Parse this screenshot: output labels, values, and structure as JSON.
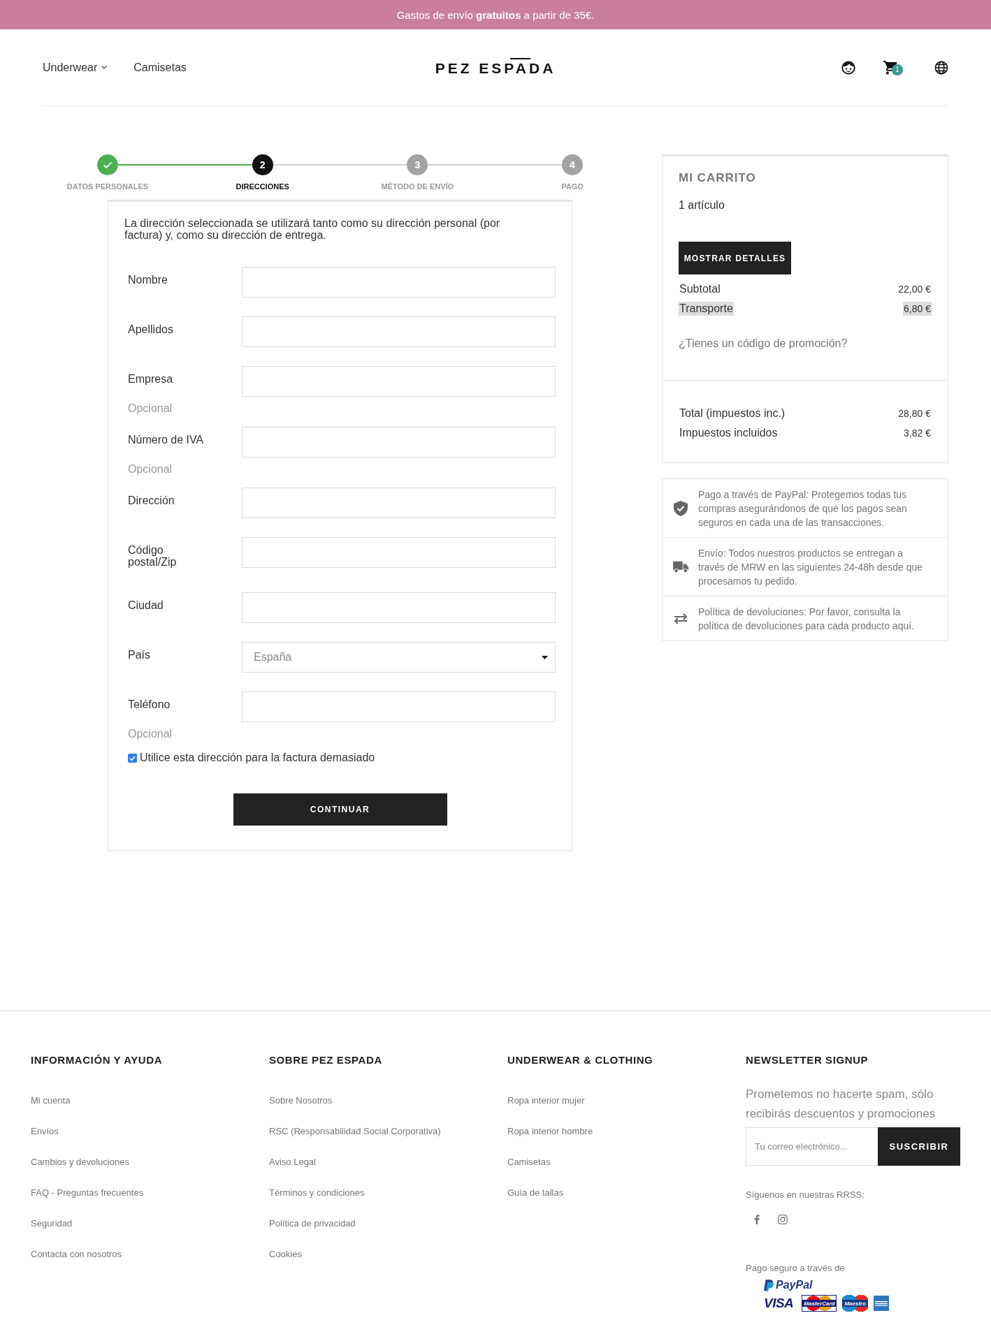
{
  "announcement": {
    "text": "Gastos de envío **gratuitos** a partir de 35€."
  },
  "header": {
    "nav": [
      {
        "label": "Underwear",
        "dropdown": true
      },
      {
        "label": "Camisetas",
        "dropdown": false
      }
    ],
    "logo": "PEZ ESPADA",
    "cart_count": "1"
  },
  "stepper": {
    "steps": [
      {
        "label": "DATOS PERSONALES",
        "done": true,
        "selected": false
      },
      {
        "number": "2",
        "label": "DIRECCIONES",
        "done": false,
        "selected": true
      },
      {
        "number": "3",
        "label": "MÉTODO DE ENVÍO",
        "done": false,
        "selected": false
      },
      {
        "number": "4",
        "label": "PAGO",
        "done": false,
        "selected": false
      }
    ]
  },
  "form": {
    "intro": "La dirección seleccionada se utilizará tanto como su dirección personal (por factura) y, como su dirección de entrega.",
    "fields": [
      {
        "kind": "text",
        "label": "Nombre"
      },
      {
        "kind": "text",
        "label": "Apellidos"
      },
      {
        "kind": "text",
        "label": "Empresa",
        "note": "Opcional"
      },
      {
        "kind": "text",
        "label": "Número de IVA",
        "note": "Opcional"
      },
      {
        "kind": "text",
        "label": "Dirección"
      },
      {
        "kind": "text",
        "label": "Código postal/Zip"
      },
      {
        "kind": "text",
        "label": "Ciudad"
      },
      {
        "kind": "select",
        "label": "País",
        "value": "España"
      },
      {
        "kind": "text",
        "label": "Teléfono",
        "note": "Opcional"
      }
    ],
    "billing_checkbox": {
      "label": "Utilice esta dirección para la factura demasiado",
      "checked": true
    },
    "submit": "CONTINUAR"
  },
  "cart": {
    "title": "MI CARRITO",
    "item_count": "1 artículo",
    "details_button": "MOSTRAR DETALLES",
    "lines": [
      {
        "label": "Subtotal",
        "value": "22,00 €",
        "highlighted": false
      },
      {
        "label": "Transporte",
        "value": "6,80 €",
        "highlighted": true
      }
    ],
    "promo_link": "¿Tienes un código de promoción?",
    "totals": [
      {
        "label": "Total (impuestos inc.)",
        "value": "28,80 €"
      },
      {
        "label": "Impuestos incluidos",
        "value": "3,82 €"
      }
    ]
  },
  "reassurance": [
    {
      "kind": "shield",
      "text": "Pago a través de PayPal: Protegemos todas tus compras asegurándonos de que los pagos sean seguros en cada una de las transacciones."
    },
    {
      "kind": "truck",
      "text": "Envío: Todos nuestros productos se entregan a través de MRW en las siguientes 24-48h desde que procesamos tu pedido."
    },
    {
      "kind": "returns",
      "text": "Política de devoluciones: Por favor, consulta la política de devoluciones para cada producto aquí."
    }
  ],
  "footer": {
    "columns": [
      {
        "title": "INFORMACIÓN Y AYUDA",
        "links": [
          "Mi cuenta",
          "Envíos",
          "Cambios y devoluciones",
          "FAQ - Preguntas frecuentes",
          "Seguridad",
          "Contacta con nosotros"
        ]
      },
      {
        "title": "SOBRE PEZ ESPADA",
        "links": [
          "Sobre Nosotros",
          "RSC (Responsabilidad Social Corporativa)",
          "Aviso Legal",
          "Términos y condiciones",
          "Política de privacidad",
          "Cookies"
        ]
      },
      {
        "title": "UNDERWEAR & CLOTHING",
        "links": [
          "Ropa interior mujer",
          "Ropa interior hombre",
          "Camisetas",
          "Guía de tallas"
        ]
      }
    ],
    "newsletter": {
      "title": "NEWSLETTER SIGNUP",
      "text": "Prometemos no hacerte spam, sólo recibirás descuentos y promociones",
      "email_placeholder": "Tu correo electrónico...",
      "button": "SUSCRIBIR",
      "social_label": "Síguenos en nuestras RRSS:",
      "payment_label": "Pago seguro a través de",
      "payment_logos": [
        {
          "kind": "paypal",
          "text": "PayPal"
        },
        {
          "kind": "visa",
          "text": "VISA"
        },
        {
          "kind": "mastercard",
          "text": "MasterCard"
        },
        {
          "kind": "maestro",
          "text": "Maestro"
        },
        {
          "kind": "amex"
        }
      ]
    }
  }
}
